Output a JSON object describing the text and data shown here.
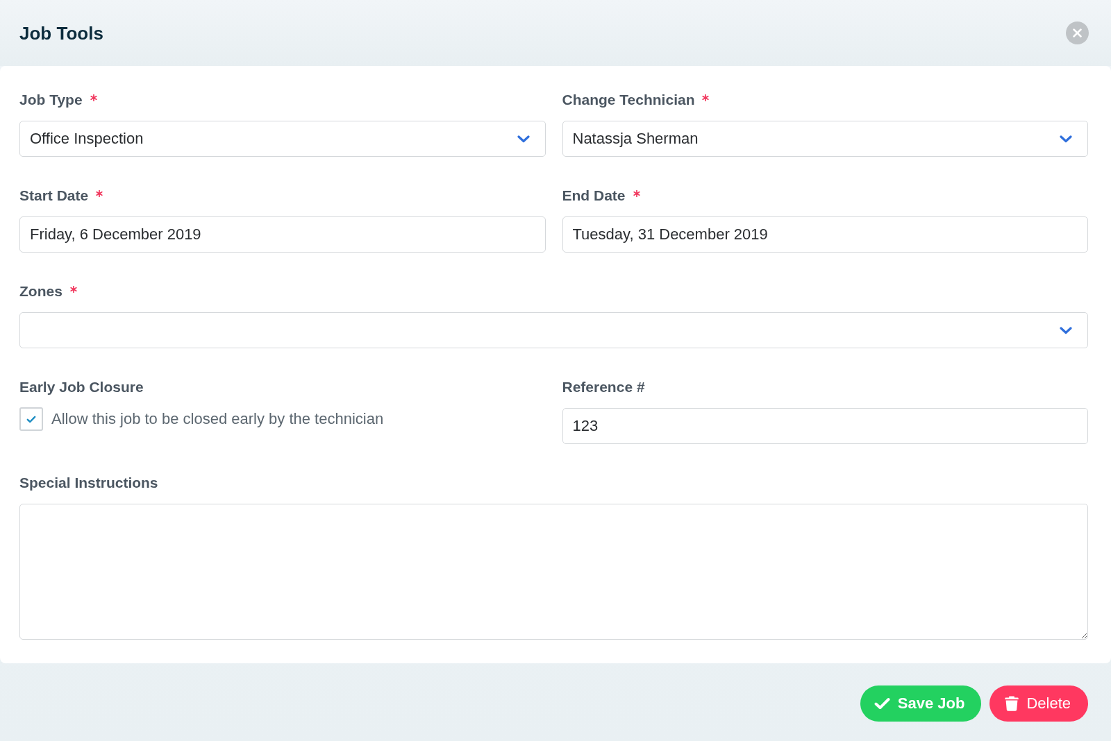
{
  "window": {
    "title": "Job Tools"
  },
  "rows": [
    {
      "fields": [
        {
          "kind": "select",
          "label": "Job Type",
          "required": true,
          "value": "Office Inspection"
        },
        {
          "kind": "select",
          "label": "Change Technician",
          "required": true,
          "value": "Natassja Sherman"
        }
      ]
    },
    {
      "fields": [
        {
          "kind": "text",
          "label": "Start Date",
          "required": true,
          "value": "Friday, 6 December 2019"
        },
        {
          "kind": "text",
          "label": "End Date",
          "required": true,
          "value": "Tuesday, 31 December 2019"
        }
      ]
    },
    {
      "fields": [
        {
          "kind": "select",
          "label": "Zones",
          "required": true
        }
      ]
    },
    {
      "fields": [
        {
          "kind": "checkbox",
          "label": "Early Job Closure",
          "required": false,
          "option": "Allow this job to be closed early by the technician",
          "checked": true
        },
        {
          "kind": "text",
          "label": "Reference #",
          "required": false,
          "value": "123"
        }
      ]
    },
    {
      "fields": [
        {
          "kind": "textarea",
          "label": "Special Instructions",
          "required": false
        }
      ]
    }
  ],
  "buttons": [
    {
      "kind": "save",
      "label": "Save Job"
    },
    {
      "kind": "delete",
      "label": "Delete"
    }
  ]
}
